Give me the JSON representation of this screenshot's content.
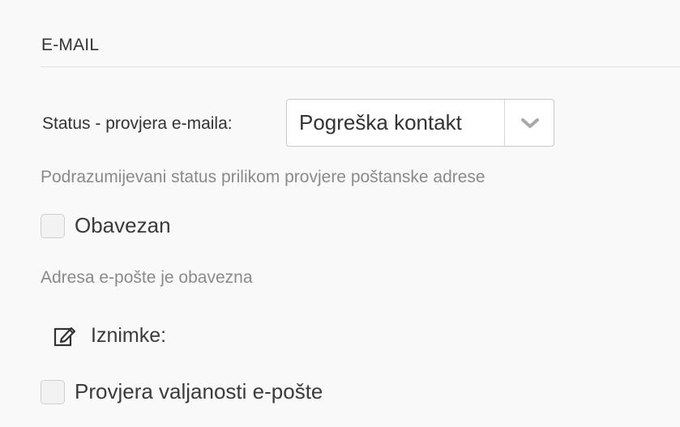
{
  "section": {
    "title": "E-MAIL"
  },
  "status_field": {
    "label": "Status - provjera e-maila:",
    "selected_value": "Pogreška kontakt",
    "help": "Podrazumijevani status prilikom provjere poštanske adrese",
    "dropdown_icon": "chevron-down-icon"
  },
  "required": {
    "label": "Obavezan",
    "checked": false,
    "help": "Adresa e-pošte je obavezna"
  },
  "exceptions": {
    "label": "Iznimke:",
    "icon": "edit-icon"
  },
  "validation": {
    "label": "Provjera valjanosti e-pošte",
    "checked": false
  }
}
